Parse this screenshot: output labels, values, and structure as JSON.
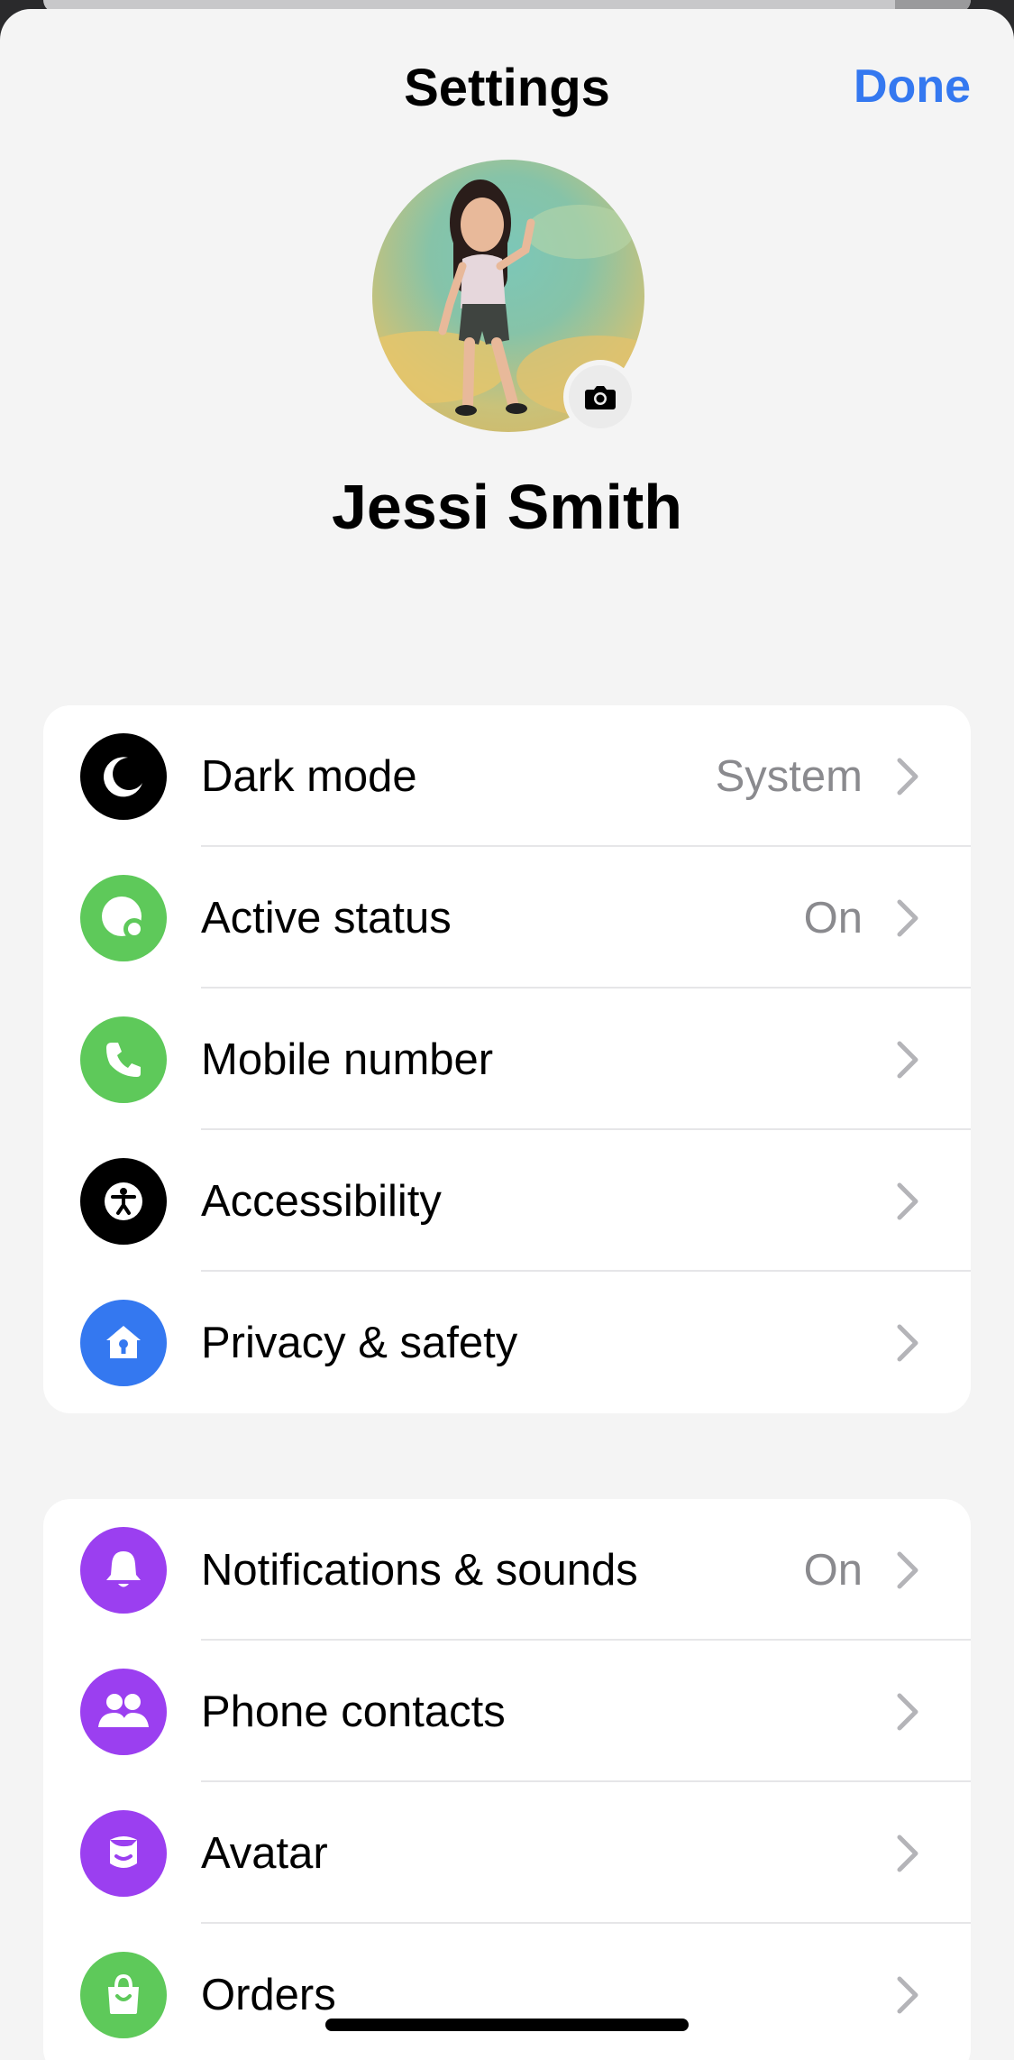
{
  "header": {
    "title": "Settings",
    "done_label": "Done"
  },
  "profile": {
    "name": "Jessi Smith"
  },
  "colors": {
    "accent": "#3478f0",
    "black_icon": "#000000",
    "green_icon": "#5ec95a",
    "blue_icon": "#3478f0",
    "purple_icon": "#9b3ff0"
  },
  "group1": {
    "items": [
      {
        "label": "Dark mode",
        "value": "System",
        "icon": "moon-icon"
      },
      {
        "label": "Active status",
        "value": "On",
        "icon": "active-status-icon"
      },
      {
        "label": "Mobile number",
        "value": "",
        "icon": "phone-icon"
      },
      {
        "label": "Accessibility",
        "value": "",
        "icon": "accessibility-icon"
      },
      {
        "label": "Privacy & safety",
        "value": "",
        "icon": "privacy-house-icon"
      }
    ]
  },
  "group2": {
    "items": [
      {
        "label": "Notifications & sounds",
        "value": "On",
        "icon": "bell-icon"
      },
      {
        "label": "Phone contacts",
        "value": "",
        "icon": "contacts-icon"
      },
      {
        "label": "Avatar",
        "value": "",
        "icon": "avatar-icon"
      },
      {
        "label": "Orders",
        "value": "",
        "icon": "shopping-bag-icon"
      }
    ]
  }
}
